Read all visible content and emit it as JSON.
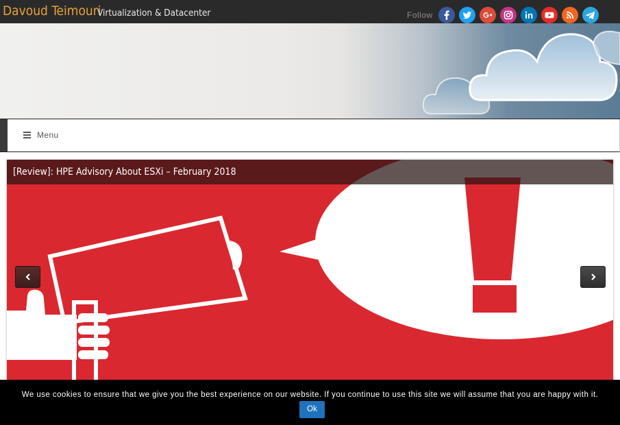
{
  "header": {
    "site_title": "Davoud Teimouri",
    "tagline": "Virtualization & Datacenter",
    "follow_label": "Follow"
  },
  "social": [
    {
      "name": "facebook-icon",
      "color": "#3b5998"
    },
    {
      "name": "twitter-icon",
      "color": "#1da1f2"
    },
    {
      "name": "google-plus-icon",
      "color": "#dd4b39"
    },
    {
      "name": "instagram-icon",
      "color": "#c13584"
    },
    {
      "name": "linkedin-icon",
      "color": "#0077b5"
    },
    {
      "name": "youtube-icon",
      "color": "#e52d27"
    },
    {
      "name": "rss-icon",
      "color": "#f26522"
    },
    {
      "name": "telegram-icon",
      "color": "#2ca5e0"
    }
  ],
  "menu": {
    "label": "Menu"
  },
  "slider": {
    "title": "[Review]: HPE Advisory About ESXi – February 2018",
    "background_color": "#d9282f"
  },
  "cookie": {
    "text": "We use cookies to ensure that we give you the best experience on our website. If you continue to use this site we will assume that you are happy with it.",
    "ok_label": "Ok",
    "ok_color": "#1e73be"
  }
}
